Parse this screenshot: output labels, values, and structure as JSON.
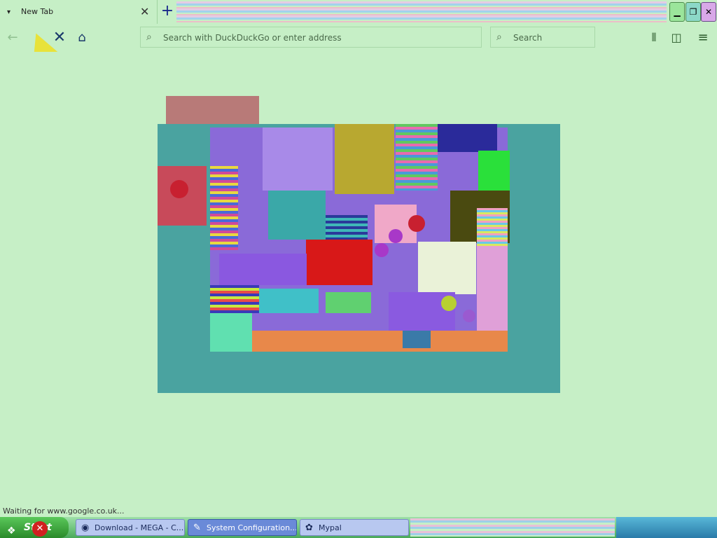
{
  "browser": {
    "tab": {
      "title": "New Tab",
      "favicon_icon": "dropdown-arrow-icon",
      "close_icon": "close-icon"
    },
    "new_tab_icon": "plus-icon",
    "window_controls": {
      "minimize": "minimize-icon",
      "maximize": "maximize-icon",
      "close": "close-icon"
    },
    "nav": {
      "back_icon": "back-arrow-icon",
      "stop_icon": "stop-icon",
      "home_icon": "home-icon",
      "url_placeholder": "Search with DuckDuckGo or enter address",
      "search_placeholder": "Search",
      "library_icon": "library-icon",
      "sidebar_icon": "sidebar-icon",
      "menu_icon": "hamburger-menu-icon"
    },
    "status": "Waiting for www.google.co.uk..."
  },
  "overlay": {
    "warning_icon": "warning-icon"
  },
  "taskbar": {
    "start_label": "Start",
    "tasks": [
      {
        "label": "Download - MEGA - C...",
        "icon": "chrome-icon"
      },
      {
        "label": "System Configuration...",
        "icon": "system-config-icon"
      },
      {
        "label": "Mypal",
        "icon": "mypal-icon"
      }
    ]
  },
  "colors": {
    "background": "#c6efc6",
    "canvas_teal": "#4aa3a0",
    "accent_blue": "#1b3a6b"
  }
}
